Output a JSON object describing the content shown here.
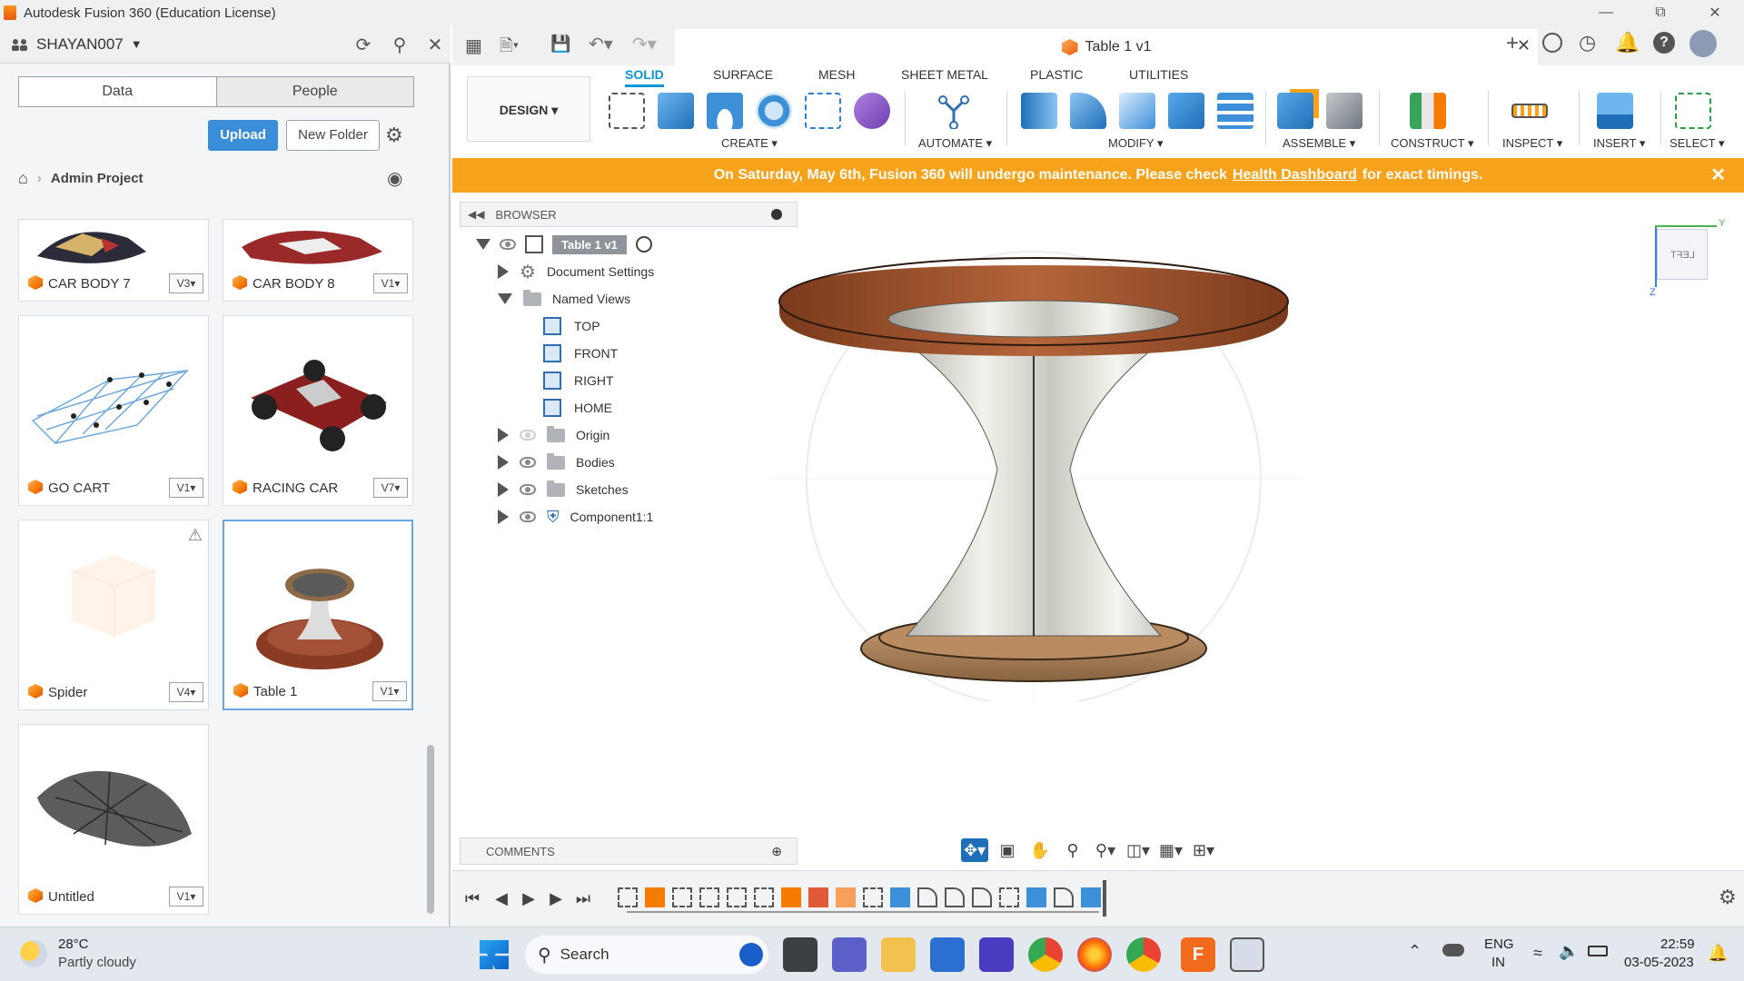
{
  "window": {
    "title": "Autodesk Fusion 360 (Education License)"
  },
  "data_panel": {
    "user": "SHAYAN007",
    "tabs": [
      "Data",
      "People"
    ],
    "upload_label": "Upload",
    "new_folder_label": "New Folder",
    "breadcrumb": "Admin Project",
    "files": [
      {
        "name": "CAR BODY 7",
        "version": "V3"
      },
      {
        "name": "CAR BODY 8",
        "version": "V1"
      },
      {
        "name": "GO CART",
        "version": "V1"
      },
      {
        "name": "RACING CAR",
        "version": "V7"
      },
      {
        "name": "Spider",
        "version": "V4"
      },
      {
        "name": "Table 1",
        "version": "V1"
      },
      {
        "name": "Untitled",
        "version": "V1"
      }
    ]
  },
  "document": {
    "tab_title": "Table 1 v1"
  },
  "toolbar": {
    "workspace": "DESIGN",
    "tabs": [
      "SOLID",
      "SURFACE",
      "MESH",
      "SHEET METAL",
      "PLASTIC",
      "UTILITIES"
    ],
    "groups": [
      "CREATE",
      "AUTOMATE",
      "MODIFY",
      "ASSEMBLE",
      "CONSTRUCT",
      "INSPECT",
      "INSERT",
      "SELECT"
    ]
  },
  "banner": {
    "text_before": "On Saturday, May 6th, Fusion 360 will undergo maintenance. Please check",
    "link": "Health Dashboard",
    "text_after": "for exact timings."
  },
  "browser": {
    "title": "BROWSER",
    "root": "Table 1 v1",
    "items": [
      "Document Settings",
      "Named Views",
      "TOP",
      "FRONT",
      "RIGHT",
      "HOME",
      "Origin",
      "Bodies",
      "Sketches",
      "Component1:1"
    ],
    "comments": "COMMENTS"
  },
  "viewcube": {
    "label": "LEFT",
    "axis_y": "Y",
    "axis_z": "Z"
  },
  "taskbar": {
    "weather_temp": "28°C",
    "weather_desc": "Partly cloudy",
    "search": "Search",
    "lang_1": "ENG",
    "lang_2": "IN",
    "time": "22:59",
    "date": "03-05-2023"
  },
  "colors": {
    "accent": "#0696d7",
    "banner": "#f7a21b",
    "upload": "#3a8dd8"
  }
}
